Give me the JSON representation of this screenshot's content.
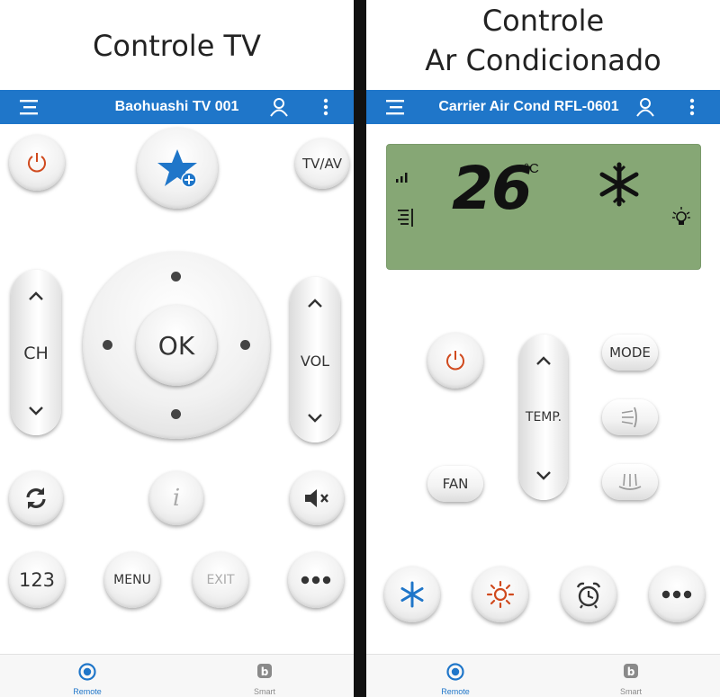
{
  "tv": {
    "caption": "Controle TV",
    "device_title": "Baohuashi TV 001",
    "tv_av_label": "TV/AV",
    "ch_label": "CH",
    "ok_label": "OK",
    "vol_label": "VOL",
    "num_label": "123",
    "menu_label": "MENU",
    "exit_label": "EXIT",
    "tabs": [
      {
        "label": "Remote"
      },
      {
        "label": "Smart"
      }
    ]
  },
  "ac": {
    "caption_line1": "Controle",
    "caption_line2": "Ar Condicionado",
    "device_title": "Carrier Air Cond RFL-0601",
    "temperature": "26",
    "temp_unit": "°C",
    "mode_label": "MODE",
    "temp_label": "TEMP.",
    "fan_label": "FAN",
    "tabs": [
      {
        "label": "Remote"
      },
      {
        "label": "Smart"
      }
    ]
  },
  "colors": {
    "appbar": "#1f76c9",
    "active_tab": "#1f76c9",
    "inactive_tab": "#8a8a8a",
    "lcd": "#86a775",
    "power": "#d04a1e"
  }
}
